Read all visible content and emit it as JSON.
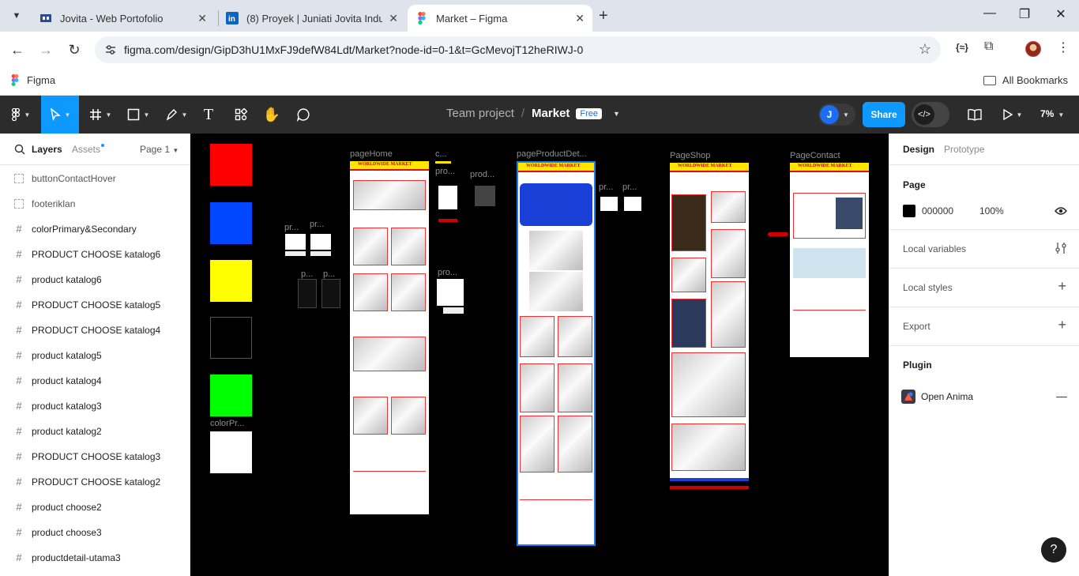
{
  "browser": {
    "tabs": [
      {
        "title": "Jovita - Web Portofolio"
      },
      {
        "title": "(8) Proyek | Juniati Jovita Indus"
      },
      {
        "title": "Market – Figma"
      }
    ],
    "url": "figma.com/design/GipD3hU1MxFJ9defW84Ldt/Market?node-id=0-1&t=GcMevojT12heRIWJ-0",
    "bookmark_figma": "Figma",
    "all_bookmarks": "All Bookmarks"
  },
  "toolbar": {
    "team": "Team project",
    "file": "Market",
    "plan_badge": "Free",
    "user_initial": "J",
    "share_label": "Share",
    "zoom": "7%"
  },
  "left_panel": {
    "tab_layers": "Layers",
    "tab_assets": "Assets",
    "page_selector": "Page 1",
    "layers": [
      {
        "name": "buttonContactHover",
        "type": "component"
      },
      {
        "name": "footeriklan",
        "type": "component"
      },
      {
        "name": "colorPrimary&Secondary",
        "type": "frame"
      },
      {
        "name": "PRODUCT CHOOSE katalog6",
        "type": "frame"
      },
      {
        "name": "product katalog6",
        "type": "frame"
      },
      {
        "name": "PRODUCT CHOOSE katalog5",
        "type": "frame"
      },
      {
        "name": "PRODUCT CHOOSE katalog4",
        "type": "frame"
      },
      {
        "name": "product katalog5",
        "type": "frame"
      },
      {
        "name": "product katalog4",
        "type": "frame"
      },
      {
        "name": "product katalog3",
        "type": "frame"
      },
      {
        "name": "product katalog2",
        "type": "frame"
      },
      {
        "name": "PRODUCT CHOOSE katalog3",
        "type": "frame"
      },
      {
        "name": "PRODUCT CHOOSE katalog2",
        "type": "frame"
      },
      {
        "name": "product choose2",
        "type": "frame"
      },
      {
        "name": "product choose3",
        "type": "frame"
      },
      {
        "name": "productdetail-utama3",
        "type": "frame"
      }
    ]
  },
  "canvas": {
    "swatch_colors": [
      "#ff0000",
      "#0047ff",
      "#ffff00",
      "#000000",
      "#00ff00",
      "#ffffff"
    ],
    "frame_labels": {
      "color": "colorPr...",
      "home": "pageHome",
      "c": "c...",
      "pro1": "pro...",
      "prod": "prod...",
      "pro2": "pro...",
      "pr1": "pr...",
      "pr2": "pr...",
      "p1": "p...",
      "p2": "p...",
      "detail": "pageProductDet...",
      "pr3": "pr...",
      "pr4": "pr...",
      "shop": "PageShop",
      "contact": "PageContact"
    },
    "site_title": "WORLDWIDE MARKET"
  },
  "right_panel": {
    "tab_design": "Design",
    "tab_prototype": "Prototype",
    "page_section": "Page",
    "page_color": "000000",
    "page_opacity": "100%",
    "local_variables": "Local variables",
    "local_styles": "Local styles",
    "export": "Export",
    "plugin": "Plugin",
    "plugin_name": "Open Anima"
  },
  "help": "?"
}
